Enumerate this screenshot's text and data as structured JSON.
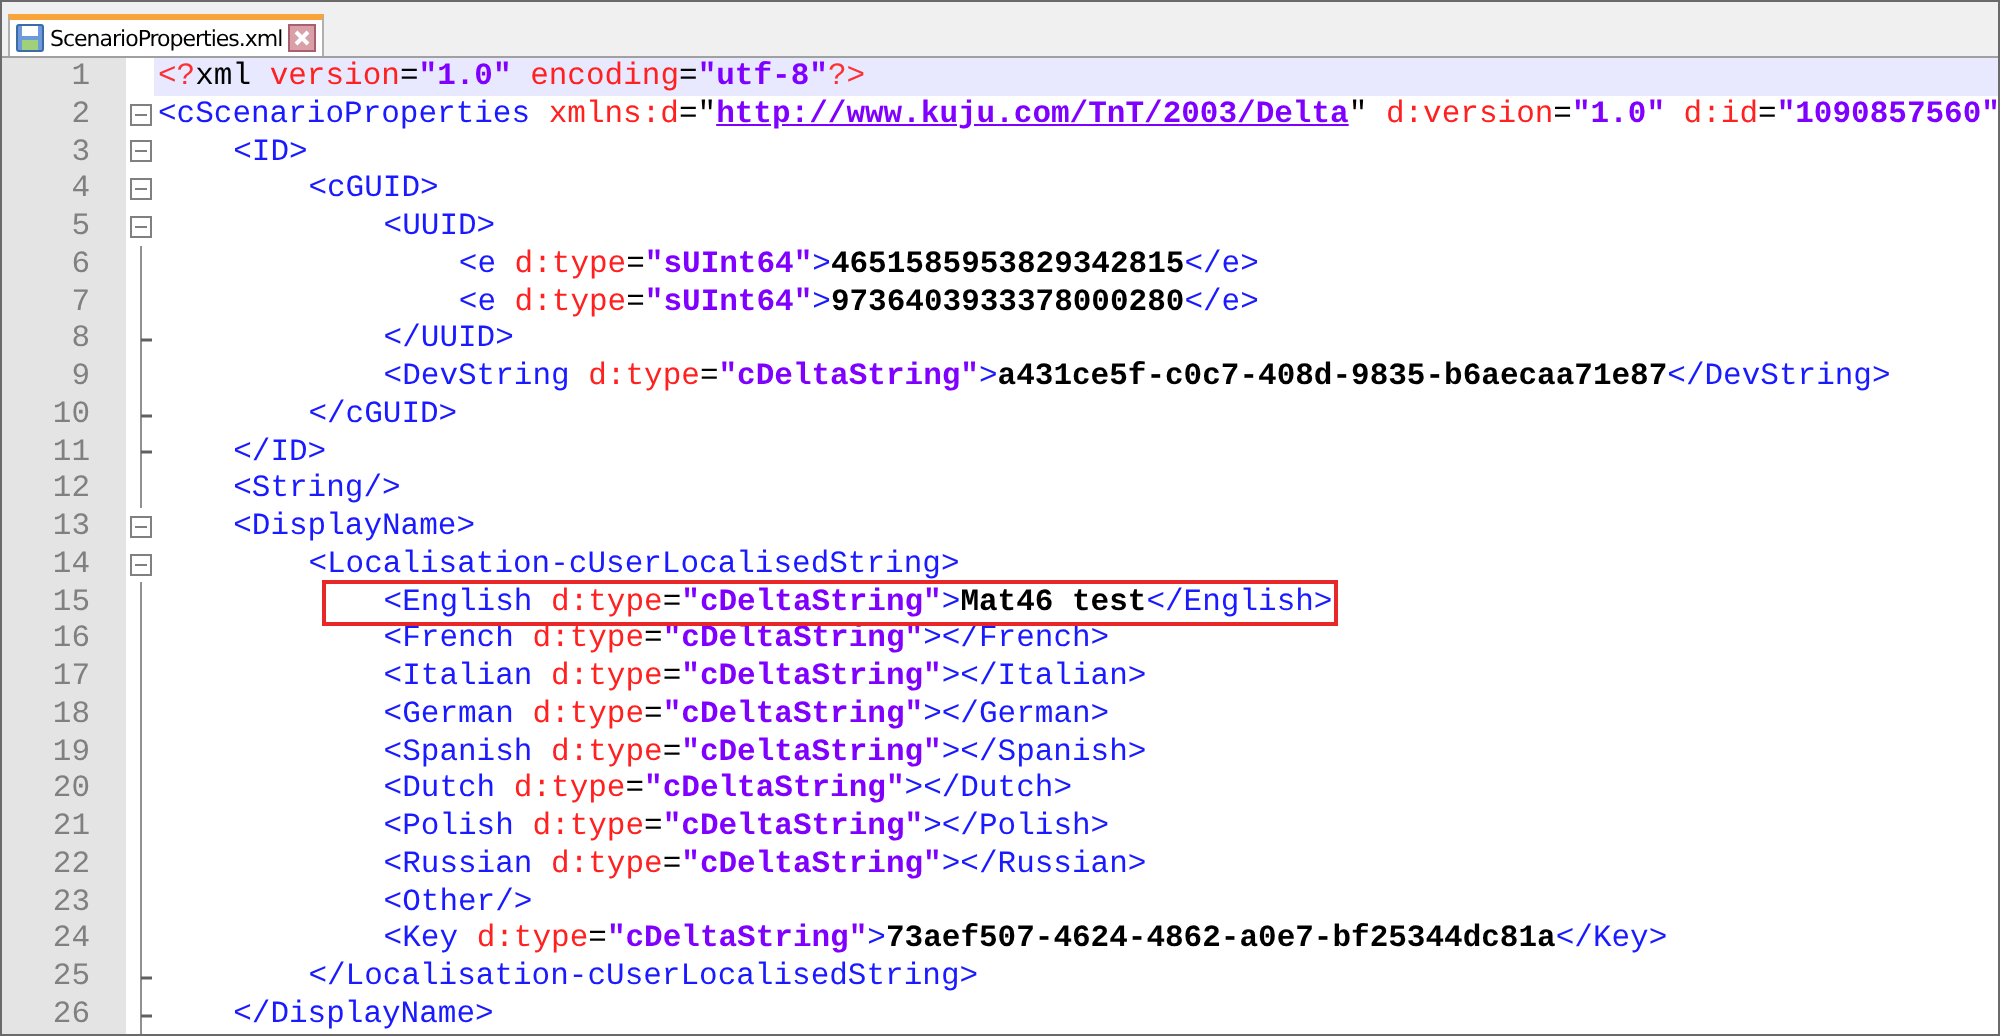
{
  "tabs": [
    {
      "label": "ScenarioProperties.xml",
      "selected": true
    }
  ],
  "editor": {
    "lines": [
      {
        "number": "1",
        "current": true,
        "tokens": [
          {
            "kind": "decl",
            "text": "<?"
          },
          {
            "kind": "punct",
            "text": "xml "
          },
          {
            "kind": "attr",
            "text": "version"
          },
          {
            "kind": "punct",
            "text": "="
          },
          {
            "kind": "val",
            "text": "\"1.0\" "
          },
          {
            "kind": "attr",
            "text": "encoding"
          },
          {
            "kind": "punct",
            "text": "="
          },
          {
            "kind": "val",
            "text": "\"utf-8\""
          },
          {
            "kind": "decl",
            "text": "?>"
          }
        ]
      },
      {
        "number": "2",
        "collapsible": true,
        "tokens": [
          {
            "kind": "tag",
            "text": "<cScenarioProperties "
          },
          {
            "kind": "attr",
            "text": "xmlns:d"
          },
          {
            "kind": "punct",
            "text": "=\""
          },
          {
            "kind": "url",
            "text": "http://www.kuju.com/TnT/2003/Delta"
          },
          {
            "kind": "punct",
            "text": "\" "
          },
          {
            "kind": "attr",
            "text": "d:version"
          },
          {
            "kind": "punct",
            "text": "="
          },
          {
            "kind": "val",
            "text": "\"1.0\" "
          },
          {
            "kind": "attr",
            "text": "d:id"
          },
          {
            "kind": "punct",
            "text": "="
          },
          {
            "kind": "val",
            "text": "\"1090857560\""
          }
        ],
        "children": [
          {
            "number": "3",
            "collapsible": true,
            "tokens": [
              {
                "kind": "tag",
                "text": "<ID>"
              }
            ],
            "children": [
              {
                "number": "4",
                "collapsible": true,
                "tokens": [
                  {
                    "kind": "tag",
                    "text": "<cGUID>"
                  }
                ],
                "children": [
                  {
                    "number": "5",
                    "collapsible": true,
                    "tokens": [
                      {
                        "kind": "tag",
                        "text": "<UUID>"
                      }
                    ],
                    "children": [
                      {
                        "number": "6",
                        "tokens": [
                          {
                            "kind": "tag",
                            "text": "<e "
                          },
                          {
                            "kind": "attr",
                            "text": "d:type"
                          },
                          {
                            "kind": "punct",
                            "text": "="
                          },
                          {
                            "kind": "val",
                            "text": "\"sUInt64\""
                          },
                          {
                            "kind": "tag",
                            "text": ">"
                          },
                          {
                            "kind": "txt",
                            "text": "4651585953829342815"
                          },
                          {
                            "kind": "tag",
                            "text": "</e>"
                          }
                        ]
                      },
                      {
                        "number": "7",
                        "tokens": [
                          {
                            "kind": "tag",
                            "text": "<e "
                          },
                          {
                            "kind": "attr",
                            "text": "d:type"
                          },
                          {
                            "kind": "punct",
                            "text": "="
                          },
                          {
                            "kind": "val",
                            "text": "\"sUInt64\""
                          },
                          {
                            "kind": "tag",
                            "text": ">"
                          },
                          {
                            "kind": "txt",
                            "text": "9736403933378000280"
                          },
                          {
                            "kind": "tag",
                            "text": "</e>"
                          }
                        ]
                      }
                    ]
                  },
                  {
                    "number": "8",
                    "block_end": true,
                    "tokens": [
                      {
                        "kind": "tag",
                        "text": "</UUID>"
                      }
                    ]
                  },
                  {
                    "number": "9",
                    "tokens": [
                      {
                        "kind": "tag",
                        "text": "<DevString "
                      },
                      {
                        "kind": "attr",
                        "text": "d:type"
                      },
                      {
                        "kind": "punct",
                        "text": "="
                      },
                      {
                        "kind": "val",
                        "text": "\"cDeltaString\""
                      },
                      {
                        "kind": "tag",
                        "text": ">"
                      },
                      {
                        "kind": "txt",
                        "text": "a431ce5f-c0c7-408d-9835-b6aecaa71e87"
                      },
                      {
                        "kind": "tag",
                        "text": "</DevString>"
                      }
                    ]
                  }
                ]
              },
              {
                "number": "10",
                "block_end": true,
                "tokens": [
                  {
                    "kind": "tag",
                    "text": "</cGUID>"
                  }
                ]
              }
            ]
          },
          {
            "number": "11",
            "block_end": true,
            "tokens": [
              {
                "kind": "tag",
                "text": "</ID>"
              }
            ]
          },
          {
            "number": "12",
            "tokens": [
              {
                "kind": "tag",
                "text": "<String/>"
              }
            ]
          },
          {
            "number": "13",
            "collapsible": true,
            "tokens": [
              {
                "kind": "tag",
                "text": "<DisplayName>"
              }
            ],
            "children": [
              {
                "number": "14",
                "collapsible": true,
                "tokens": [
                  {
                    "kind": "tag",
                    "text": "<Localisation-cUserLocalisedString>"
                  }
                ],
                "children": [
                  {
                    "number": "15",
                    "boxed": true,
                    "tokens": [
                      {
                        "kind": "tag",
                        "text": "<English "
                      },
                      {
                        "kind": "attr",
                        "text": "d:type"
                      },
                      {
                        "kind": "punct",
                        "text": "="
                      },
                      {
                        "kind": "val",
                        "text": "\"cDeltaString\""
                      },
                      {
                        "kind": "tag",
                        "text": ">"
                      },
                      {
                        "kind": "txt",
                        "text": "Mat46 test"
                      },
                      {
                        "kind": "tag",
                        "text": "</English>"
                      }
                    ]
                  },
                  {
                    "number": "16",
                    "tokens": [
                      {
                        "kind": "tag",
                        "text": "<French "
                      },
                      {
                        "kind": "attr",
                        "text": "d:type"
                      },
                      {
                        "kind": "punct",
                        "text": "="
                      },
                      {
                        "kind": "val",
                        "text": "\"cDeltaString\""
                      },
                      {
                        "kind": "tag",
                        "text": "></French>"
                      }
                    ]
                  },
                  {
                    "number": "17",
                    "tokens": [
                      {
                        "kind": "tag",
                        "text": "<Italian "
                      },
                      {
                        "kind": "attr",
                        "text": "d:type"
                      },
                      {
                        "kind": "punct",
                        "text": "="
                      },
                      {
                        "kind": "val",
                        "text": "\"cDeltaString\""
                      },
                      {
                        "kind": "tag",
                        "text": "></Italian>"
                      }
                    ]
                  },
                  {
                    "number": "18",
                    "tokens": [
                      {
                        "kind": "tag",
                        "text": "<German "
                      },
                      {
                        "kind": "attr",
                        "text": "d:type"
                      },
                      {
                        "kind": "punct",
                        "text": "="
                      },
                      {
                        "kind": "val",
                        "text": "\"cDeltaString\""
                      },
                      {
                        "kind": "tag",
                        "text": "></German>"
                      }
                    ]
                  },
                  {
                    "number": "19",
                    "tokens": [
                      {
                        "kind": "tag",
                        "text": "<Spanish "
                      },
                      {
                        "kind": "attr",
                        "text": "d:type"
                      },
                      {
                        "kind": "punct",
                        "text": "="
                      },
                      {
                        "kind": "val",
                        "text": "\"cDeltaString\""
                      },
                      {
                        "kind": "tag",
                        "text": "></Spanish>"
                      }
                    ]
                  },
                  {
                    "number": "20",
                    "tokens": [
                      {
                        "kind": "tag",
                        "text": "<Dutch "
                      },
                      {
                        "kind": "attr",
                        "text": "d:type"
                      },
                      {
                        "kind": "punct",
                        "text": "="
                      },
                      {
                        "kind": "val",
                        "text": "\"cDeltaString\""
                      },
                      {
                        "kind": "tag",
                        "text": "></Dutch>"
                      }
                    ]
                  },
                  {
                    "number": "21",
                    "tokens": [
                      {
                        "kind": "tag",
                        "text": "<Polish "
                      },
                      {
                        "kind": "attr",
                        "text": "d:type"
                      },
                      {
                        "kind": "punct",
                        "text": "="
                      },
                      {
                        "kind": "val",
                        "text": "\"cDeltaString\""
                      },
                      {
                        "kind": "tag",
                        "text": "></Polish>"
                      }
                    ]
                  },
                  {
                    "number": "22",
                    "tokens": [
                      {
                        "kind": "tag",
                        "text": "<Russian "
                      },
                      {
                        "kind": "attr",
                        "text": "d:type"
                      },
                      {
                        "kind": "punct",
                        "text": "="
                      },
                      {
                        "kind": "val",
                        "text": "\"cDeltaString\""
                      },
                      {
                        "kind": "tag",
                        "text": "></Russian>"
                      }
                    ]
                  },
                  {
                    "number": "23",
                    "tokens": [
                      {
                        "kind": "tag",
                        "text": "<Other/>"
                      }
                    ]
                  },
                  {
                    "number": "24",
                    "tokens": [
                      {
                        "kind": "tag",
                        "text": "<Key "
                      },
                      {
                        "kind": "attr",
                        "text": "d:type"
                      },
                      {
                        "kind": "punct",
                        "text": "="
                      },
                      {
                        "kind": "val",
                        "text": "\"cDeltaString\""
                      },
                      {
                        "kind": "tag",
                        "text": ">"
                      },
                      {
                        "kind": "txt",
                        "text": "73aef507-4624-4862-a0e7-bf25344dc81a"
                      },
                      {
                        "kind": "tag",
                        "text": "</Key>"
                      }
                    ]
                  }
                ]
              },
              {
                "number": "25",
                "block_end": true,
                "tokens": [
                  {
                    "kind": "tag",
                    "text": "</Localisation-cUserLocalisedString>"
                  }
                ]
              }
            ]
          },
          {
            "number": "26",
            "block_end": true,
            "tokens": [
              {
                "kind": "tag",
                "text": "</DisplayName>"
              }
            ]
          }
        ]
      }
    ]
  }
}
